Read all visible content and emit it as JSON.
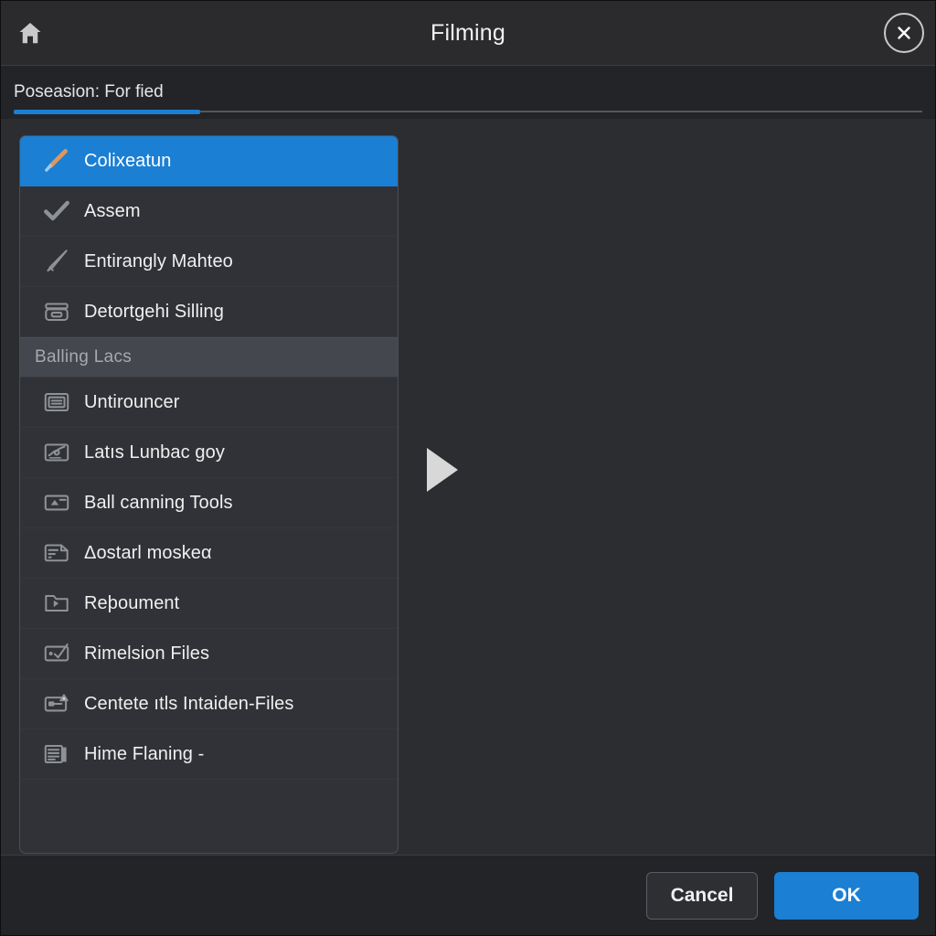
{
  "window": {
    "title": "Filming",
    "home_icon": "home-icon",
    "close_icon": "close-circle-icon"
  },
  "tabs": [
    {
      "label": "Poseasion: For fied",
      "active": true
    }
  ],
  "list": {
    "items": [
      {
        "label": "Colixeatun",
        "icon": "pen-diagonal-icon",
        "type": "item",
        "selected": true
      },
      {
        "label": "Assem",
        "icon": "checkmark-icon",
        "type": "item",
        "selected": false
      },
      {
        "label": "Entirangly Mahteo",
        "icon": "brush-icon",
        "type": "item",
        "selected": false
      },
      {
        "label": "Detortgehi Silling",
        "icon": "stamp-icon",
        "type": "item",
        "selected": false
      },
      {
        "label": "Balling Lacs",
        "icon": "",
        "type": "header",
        "selected": false
      },
      {
        "label": "Untirouncer",
        "icon": "card-lines-icon",
        "type": "item",
        "selected": false
      },
      {
        "label": "Latıs Lunbac goy",
        "icon": "card-signature-icon",
        "type": "item",
        "selected": false
      },
      {
        "label": "Ball canning Tools",
        "icon": "card-upload-icon",
        "type": "item",
        "selected": false
      },
      {
        "label": "Δostarl moskeα",
        "icon": "card-note-icon",
        "type": "item",
        "selected": false
      },
      {
        "label": "Reϸoument",
        "icon": "folder-arrow-icon",
        "type": "item",
        "selected": false
      },
      {
        "label": "Rimelsion Files",
        "icon": "card-check-icon",
        "type": "item",
        "selected": false
      },
      {
        "label": "Centete ıtls Intaiden-Files",
        "icon": "card-badge-icon",
        "type": "item",
        "selected": false
      },
      {
        "label": "Hime Flaning -",
        "icon": "document-book-icon",
        "type": "item",
        "selected": false
      }
    ]
  },
  "right_pane": {
    "expand_icon": "play-triangle-icon"
  },
  "footer": {
    "cancel_label": "Cancel",
    "ok_label": "OK"
  },
  "colors": {
    "accent": "#1b7fd4",
    "window_bg": "#2b2d31",
    "panel_bg": "#303237",
    "group_header_bg": "#44474d",
    "text": "#f0f0f0",
    "muted_text": "#a6a9ad"
  }
}
